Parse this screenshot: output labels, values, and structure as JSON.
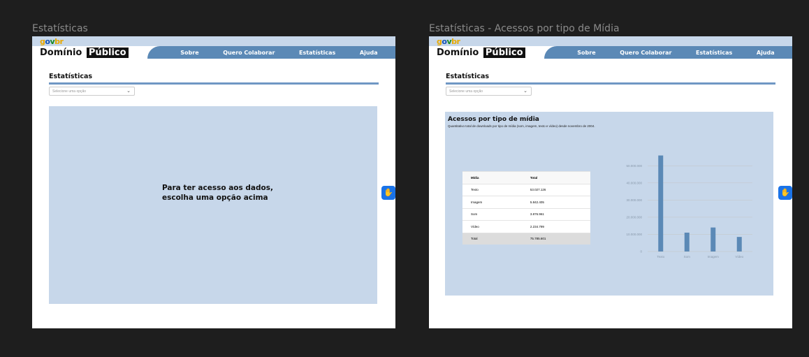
{
  "frames": [
    {
      "title": "Estatísticas"
    },
    {
      "title": "Estatísticas - Acessos por tipo de Mídia"
    }
  ],
  "header": {
    "govbr": {
      "g": "g",
      "o": "o",
      "v": "v",
      "br": "br"
    },
    "brand_left": "Domínio",
    "brand_right": "Público"
  },
  "nav": {
    "items": [
      "Sobre",
      "Quero Colaborar",
      "Estatísticas",
      "Ajuda"
    ]
  },
  "section": {
    "title": "Estatísticas"
  },
  "select": {
    "placeholder": "Selecione uma opção"
  },
  "empty_state": {
    "line1": "Para ter acesso aos dados,",
    "line2": "escolha uma opção acima"
  },
  "accessibility": {
    "icon": "sign-language-icon",
    "glyph": "✋"
  },
  "media_chart": {
    "title": "Acessos por tipo de mídia",
    "subtitle": "Quantitativo total de downloads por tipo de mídia (som, imagem, texto e vídeo) desde novembro de 2004.",
    "table": {
      "headers": [
        "Mídia",
        "Total"
      ],
      "rows": [
        [
          "Texto",
          "53.027.126"
        ],
        [
          "Imagem",
          "5.842.405"
        ],
        [
          "Som",
          "3.876.961"
        ],
        [
          "Vídeo",
          "2.234.799"
        ]
      ],
      "total": [
        "Total",
        "75.785.601"
      ]
    }
  },
  "chart_data": {
    "type": "bar",
    "categories": [
      "Texto",
      "Som",
      "Imagem",
      "Vídeo"
    ],
    "values": [
      56000000,
      11000000,
      14000000,
      8500000
    ],
    "yticks": [
      "50.000.000",
      "40.000.000",
      "30.000.000",
      "20.000.000",
      "10.000.000",
      "0"
    ],
    "ytick_values": [
      50000000,
      40000000,
      30000000,
      20000000,
      10000000,
      0
    ],
    "ylim": [
      0,
      55000000
    ],
    "title": "",
    "xlabel": "",
    "ylabel": "",
    "grid": true,
    "colors": {
      "bar": "#5b89b6",
      "grid": "#c4c4c4",
      "tick": "#8898aa",
      "panel": "#c7d7ea"
    }
  }
}
